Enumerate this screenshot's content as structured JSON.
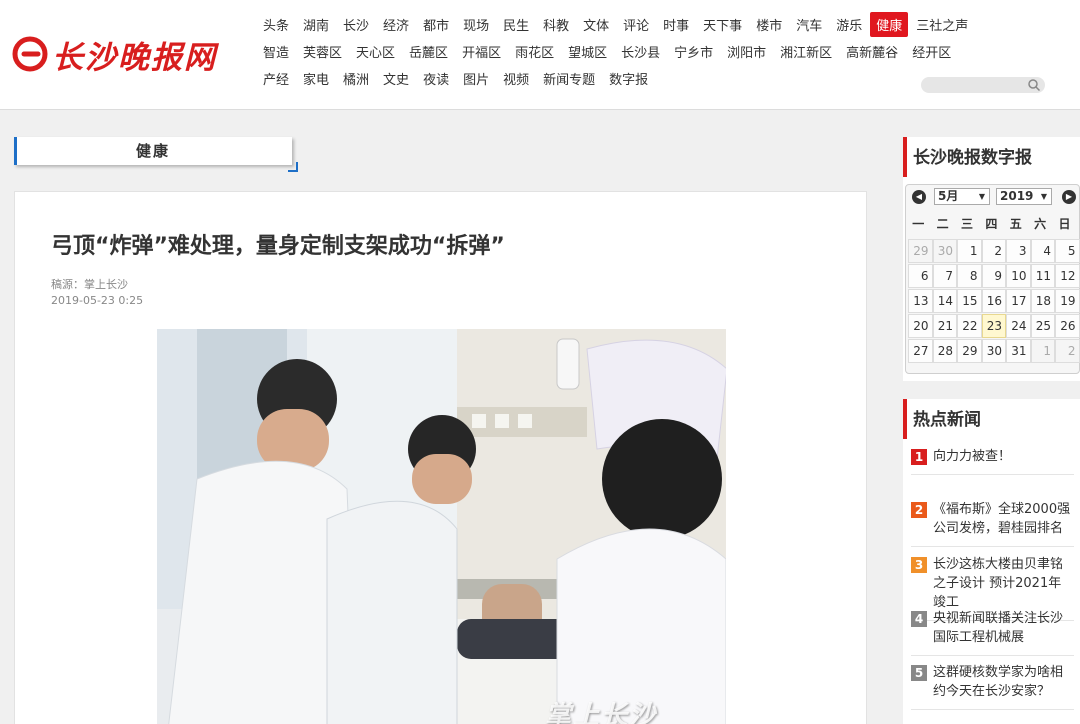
{
  "site": {
    "logo_text": "长沙晚报网",
    "brand_color": "#d81e1e"
  },
  "nav": {
    "row1": [
      "头条",
      "湖南",
      "长沙",
      "经济",
      "都市",
      "现场",
      "民生",
      "科教",
      "文体",
      "评论",
      "时事",
      "天下事",
      "楼市",
      "汽车",
      "游乐",
      "健康",
      "三社之声"
    ],
    "row2": [
      "智造",
      "芙蓉区",
      "天心区",
      "岳麓区",
      "开福区",
      "雨花区",
      "望城区",
      "长沙县",
      "宁乡市",
      "浏阳市",
      "湘江新区",
      "高新麓谷",
      "经开区"
    ],
    "row3": [
      "产经",
      "家电",
      "橘洲",
      "文史",
      "夜读",
      "图片",
      "视频",
      "新闻专题",
      "数字报"
    ],
    "active": "健康",
    "active_color": "#e0171f"
  },
  "search": {
    "placeholder": ""
  },
  "channel": {
    "label": "健康"
  },
  "article": {
    "title": "弓顶“炸弹”难处理，量身定制支架成功“拆弹”",
    "source": "稿源：掌上长沙",
    "date": "2019-05-23 0:25",
    "watermark": "掌上长沙"
  },
  "digital_paper": {
    "title": "长沙晚报数字报",
    "month": "5月",
    "year": "2019",
    "weekdays": [
      "一",
      "二",
      "三",
      "四",
      "五",
      "六",
      "日"
    ],
    "weeks": [
      [
        "29",
        "30",
        "1",
        "2",
        "3",
        "4",
        "5"
      ],
      [
        "6",
        "7",
        "8",
        "9",
        "10",
        "11",
        "12"
      ],
      [
        "13",
        "14",
        "15",
        "16",
        "17",
        "18",
        "19"
      ],
      [
        "20",
        "21",
        "22",
        "23",
        "24",
        "25",
        "26"
      ],
      [
        "27",
        "28",
        "29",
        "30",
        "31",
        "1",
        "2"
      ]
    ],
    "today": "23"
  },
  "hot_news": {
    "title": "热点新闻",
    "items": [
      {
        "num": "1",
        "text": "向力力被查！",
        "color": "#d81e1e"
      },
      {
        "num": "2",
        "text": "《福布斯》全球2000强公司发榜，碧桂园排名",
        "color": "#ea5a1b"
      },
      {
        "num": "3",
        "text": "长沙这栋大楼由贝聿铭之子设计 预计2021年竣工",
        "color": "#f0902a"
      },
      {
        "num": "4",
        "text": "央视新闻联播关注长沙国际工程机械展",
        "color": "#888888"
      },
      {
        "num": "5",
        "text": "这群硬核数学家为啥相约今天在长沙安家？",
        "color": "#888888"
      }
    ]
  }
}
